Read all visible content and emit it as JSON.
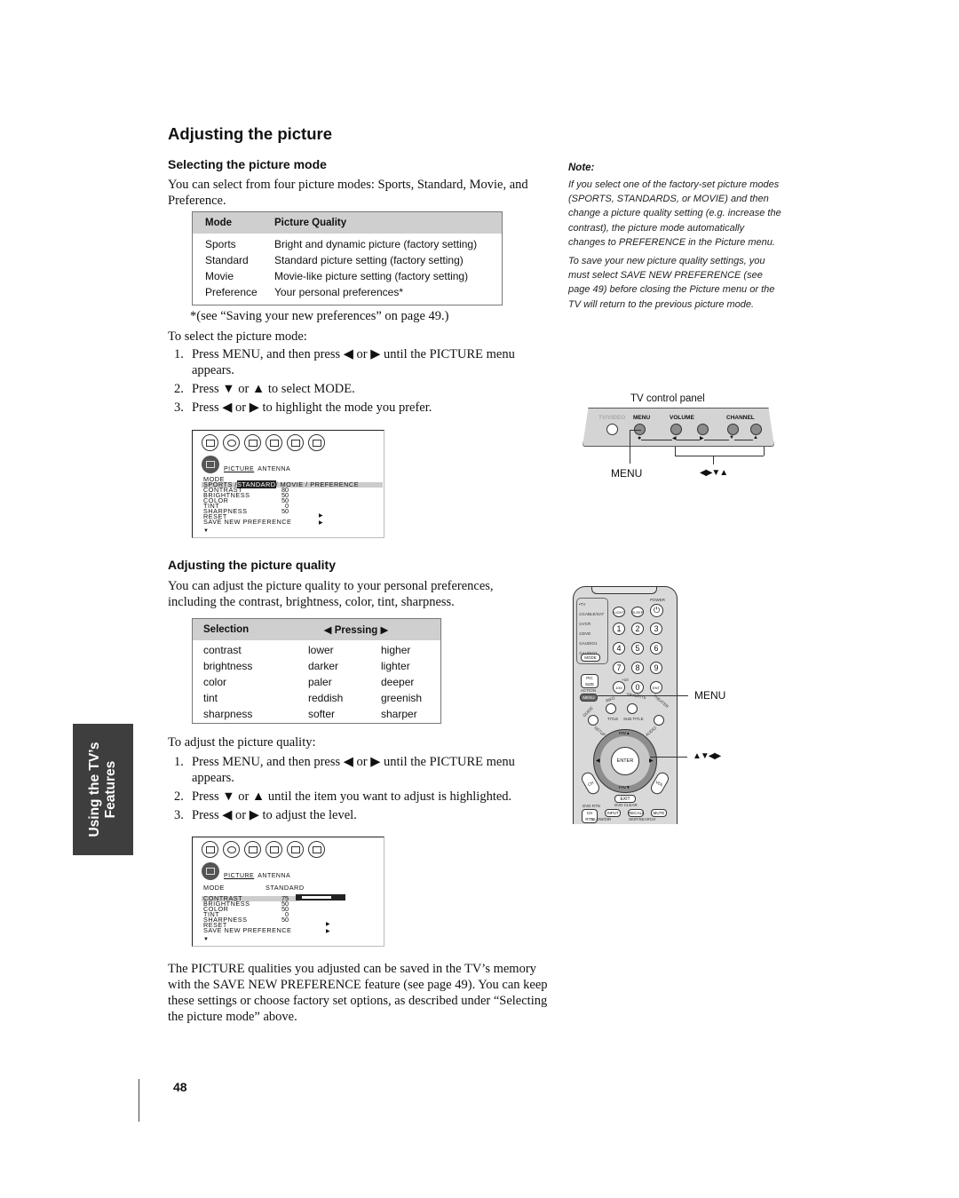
{
  "page": {
    "title": "Adjusting the picture",
    "page_number": "48",
    "side_tab": {
      "line1": "Using the TV’s",
      "line2": "Features"
    }
  },
  "mode_section": {
    "heading": "Selecting the picture mode",
    "intro": "You can select from four picture modes: Sports, Standard, Movie, and Preference.",
    "table": {
      "headers": [
        "Mode",
        "Picture Quality"
      ],
      "rows": [
        [
          "Sports",
          "Bright and dynamic picture (factory setting)"
        ],
        [
          "Standard",
          "Standard picture setting (factory setting)"
        ],
        [
          "Movie",
          "Movie-like picture setting (factory setting)"
        ],
        [
          "Preference",
          "Your personal preferences*"
        ]
      ]
    },
    "footnote": "*(see “Saving your new preferences” on page 49.)",
    "steps_intro": "To select the picture mode:",
    "steps": [
      "Press MENU, and then press ◀ or ▶ until the PICTURE menu appears.",
      "Press ▼ or ▲ to select MODE.",
      "Press ◀ or ▶ to highlight the mode you prefer."
    ]
  },
  "osd1": {
    "tab_active": "PICTURE",
    "tab_other": "ANTENNA",
    "mode_label": "MODE",
    "mode_options": {
      "before": "SPORTS /",
      "selected": "STANDARD",
      "after": "/ MOVIE / PREFERENCE"
    },
    "items": [
      {
        "label": "CONTRAST",
        "value": "80"
      },
      {
        "label": "BRIGHTNESS",
        "value": "50"
      },
      {
        "label": "COLOR",
        "value": "50"
      },
      {
        "label": "TINT",
        "value": "0"
      },
      {
        "label": "SHARPNESS",
        "value": "50"
      }
    ],
    "reset": "RESET",
    "save": "SAVE  NEW    PREFERENCE"
  },
  "quality_section": {
    "heading": "Adjusting the picture quality",
    "intro": "You can adjust the picture quality to your personal preferences, including the contrast, brightness, color, tint, sharpness.",
    "table": {
      "headers": [
        "Selection",
        "◀  Pressing  ▶"
      ],
      "rows": [
        [
          "contrast",
          "lower",
          "higher"
        ],
        [
          "brightness",
          "darker",
          "lighter"
        ],
        [
          "color",
          "paler",
          "deeper"
        ],
        [
          "tint",
          "reddish",
          "greenish"
        ],
        [
          "sharpness",
          "softer",
          "sharper"
        ]
      ]
    },
    "steps_intro": "To adjust the picture quality:",
    "steps": [
      "Press MENU, and then press ◀ or ▶ until the PICTURE menu appears.",
      "Press ▼ or ▲ until the item you want to adjust is highlighted.",
      "Press ◀ or ▶ to adjust the level."
    ],
    "closing": "The PICTURE qualities you adjusted can be saved in the TV’s memory with the SAVE NEW PREFERENCE feature (see page 49). You can keep these settings or choose factory set options, as described under “Selecting the picture mode” above."
  },
  "osd2": {
    "tab_active": "PICTURE",
    "tab_other": "ANTENNA",
    "mode_label": "MODE",
    "mode_value": "STANDARD",
    "items": [
      {
        "label": "CONTRAST",
        "value": "75"
      },
      {
        "label": "BRIGHTNESS",
        "value": "50"
      },
      {
        "label": "COLOR",
        "value": "50"
      },
      {
        "label": "TINT",
        "value": "0"
      },
      {
        "label": "SHARPNESS",
        "value": "50"
      }
    ],
    "contrast_slider_level": 0.75,
    "reset": "RESET",
    "save": "SAVE  NEW    PREFERENCE"
  },
  "note": {
    "title": "Note:",
    "paragraphs": [
      "If you select one of the factory-set picture modes (SPORTS, STANDARDS, or MOVIE) and then change a picture quality setting (e.g. increase the contrast), the picture mode automatically changes to PREFERENCE in the Picture menu.",
      "To save your new picture quality settings, you must select SAVE NEW PREFERENCE (see page 49) before closing the Picture menu or the TV will return to the previous picture mode."
    ]
  },
  "control_panel": {
    "caption": "TV control panel",
    "labels": {
      "tv_video": "TV/VIDEO",
      "menu": "MENU",
      "volume": "VOLUME",
      "channel": "CHANNEL"
    },
    "callout_menu": "MENU",
    "callout_arrows": "◀▶▼▲"
  },
  "remote": {
    "modes": [
      "•TV",
      "⊙CABLE/SAT",
      "⊙VCR",
      "⊙DVD",
      "⊙AUDIO1",
      "⊙AUDIO2"
    ],
    "mode_btn": "MODE",
    "power": "POWER",
    "light": "LIGHT",
    "sleep": "SLEEP",
    "digits": [
      "1",
      "2",
      "3",
      "4",
      "5",
      "6",
      "7",
      "8",
      "9"
    ],
    "btn_100": "100/",
    "plus10": "+10",
    "btn_0": "0",
    "btn_ent": "ENT",
    "pic_size": "PIC SIZE",
    "action": "ACTION",
    "menu": "MENU",
    "info": "INFO",
    "favorite": "FAVORITE",
    "theater": "THEATER",
    "guide": "GUIDE",
    "title": "TITLE",
    "subtitle": "SUB TITLE",
    "setup": "SETUP",
    "audio": "AUDIO",
    "fav_up": "FAV▲",
    "fav_down": "FAV▼",
    "enter": "ENTER",
    "ch": "CH",
    "vol": "VOL",
    "exit": "EXIT",
    "dvd_clear": "DVD CLEAR",
    "dvd_rtn": "DVD RTN",
    "ch_rtn": "CH RTN",
    "input": "INPUT",
    "recall": "RECALL",
    "mute": "MUTE",
    "slow_dir": "SLOW/DIR",
    "skip_search": "SKIP/SEARCH",
    "callout_menu": "MENU",
    "callout_arrows": "▲▼◀▶"
  }
}
